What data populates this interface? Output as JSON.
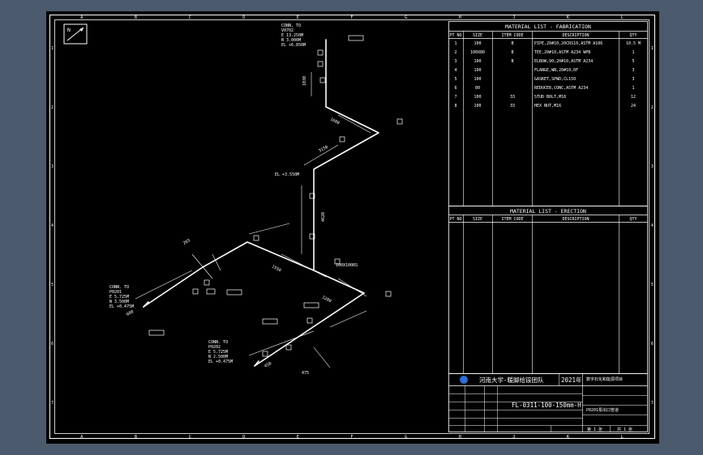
{
  "grid": {
    "columns": [
      "A",
      "B",
      "C",
      "D",
      "E",
      "F",
      "G",
      "H",
      "J",
      "K",
      "L"
    ],
    "rows": [
      "1",
      "2",
      "3",
      "4",
      "5",
      "6",
      "7"
    ]
  },
  "north": "N",
  "fabrication": {
    "title": "MATERIAL LIST - FABRICATION",
    "headers": [
      "PT NO",
      "SIZE",
      "ITEM CODE",
      "DESCRIPTION",
      "QTY"
    ],
    "rows": [
      [
        "1",
        "100",
        "B",
        "PIPE,20#10,20CRS10,ASTM A106",
        "10.5 M"
      ],
      [
        "2",
        "100X80",
        "B",
        "TEE,20#10,ASTM A234 WPB",
        "1"
      ],
      [
        "3",
        "100",
        "B",
        "ELBOW,90,20#10,ASTM A234",
        "5"
      ],
      [
        "4",
        "100",
        "",
        "FLANGE,WN,20#10,RF",
        "3"
      ],
      [
        "5",
        "100",
        "",
        "GASKET,SPWD,CL150",
        "3"
      ],
      [
        "6",
        "80",
        "",
        "REDUCER,CONC,ASTM A234",
        "1"
      ],
      [
        "7",
        "100",
        "33",
        "STUD BOLT,M16",
        "12"
      ],
      [
        "8",
        "100",
        "33",
        "HEX NUT,M16",
        "24"
      ]
    ]
  },
  "erection": {
    "title": "MATERIAL LIST - ERECTION",
    "headers": [
      "PT NO",
      "SIZE",
      "ITEM CODE",
      "DESCRIPTION",
      "QTY"
    ]
  },
  "iso": {
    "top_conn": [
      "CONN. TO",
      "V0702",
      "E 13.250M",
      "N 3.000M",
      "EL +6.850M"
    ],
    "left_conn": [
      "CONN. TO",
      "P0201",
      "E 5.725M",
      "N 3.500M",
      "EL +0.475M"
    ],
    "bottom_conn": [
      "CONN. TO",
      "P0202",
      "E 5.725M",
      "N 2.500M",
      "EL +0.475M"
    ],
    "el_label": "EL +3.550M",
    "reducer_label": "100X100RS",
    "dims": [
      "1030",
      "1600",
      "4620",
      "3150",
      "1550",
      "1200",
      "265",
      "475",
      "600",
      "450"
    ]
  },
  "title_block": {
    "school": "河南大学-暖脚给铵团队",
    "year": "2021年",
    "drawing_no": "FL-0311-100-150mm-H",
    "project": "数字石化和能源项目",
    "name": "P0201泵出口管道",
    "sheet": "第 1 张",
    "total": "共 1 张"
  },
  "colors": {
    "page": "#4b5a6c",
    "sheet": "#000000",
    "line": "#ffffff"
  }
}
